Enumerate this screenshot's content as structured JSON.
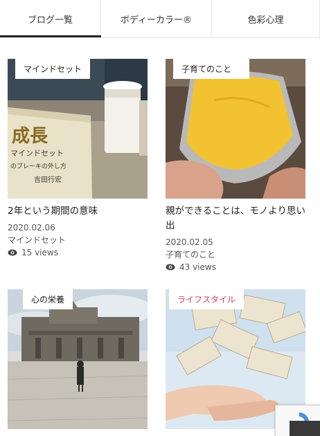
{
  "tabs": [
    {
      "label": "ブログ一覧",
      "active": true
    },
    {
      "label": "ボディーカラー®",
      "active": false
    },
    {
      "label": "色彩心理",
      "active": false
    }
  ],
  "posts": [
    {
      "category": "マインドセット",
      "title": "2年という期間の意味",
      "date": "2020.02.06",
      "category_meta": "マインドセット",
      "views": "15 views",
      "image": "book-and-coffee-photo"
    },
    {
      "category": "子育てのこと",
      "title": "親ができることは、モノより思い出",
      "date": "2020.02.05",
      "category_meta": "子育てのこと",
      "views": "43 views",
      "image": "sweet-potato-photo"
    },
    {
      "category": "心の栄養",
      "image": "temple-courtyard-photo"
    },
    {
      "category": "ライフスタイル",
      "category_color": "#d63a63",
      "image": "banknotes-in-hands-photo"
    }
  ]
}
